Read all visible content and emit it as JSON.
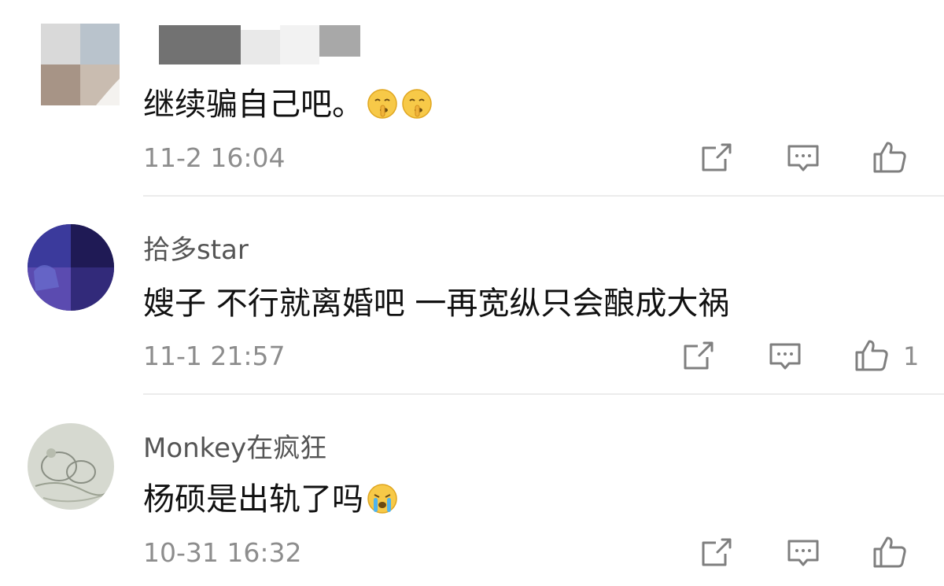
{
  "comments": [
    {
      "author": "",
      "text": "继续骗自己吧。",
      "emojis": [
        "shushing-face-emoji",
        "shushing-face-emoji"
      ],
      "time": "11-2 16:04",
      "likes": ""
    },
    {
      "author": "拾多star",
      "text": "嫂子  不行就离婚吧  一再宽纵只会酿成大祸",
      "emojis": [],
      "time": "11-1 21:57",
      "likes": "1"
    },
    {
      "author": "Monkey在疯狂",
      "text": "杨硕是出轨了吗",
      "emojis": [
        "crying-face-emoji"
      ],
      "time": "10-31 16:32",
      "likes": ""
    }
  ],
  "icons": {
    "share": "share-edit-icon",
    "reply": "reply-comment-icon",
    "like": "thumbs-up-icon"
  },
  "colors": {
    "icon": "#7f7f7f",
    "timestamp": "#8d8d8d",
    "author": "#555555",
    "text": "#111111",
    "divider": "#ececec"
  }
}
